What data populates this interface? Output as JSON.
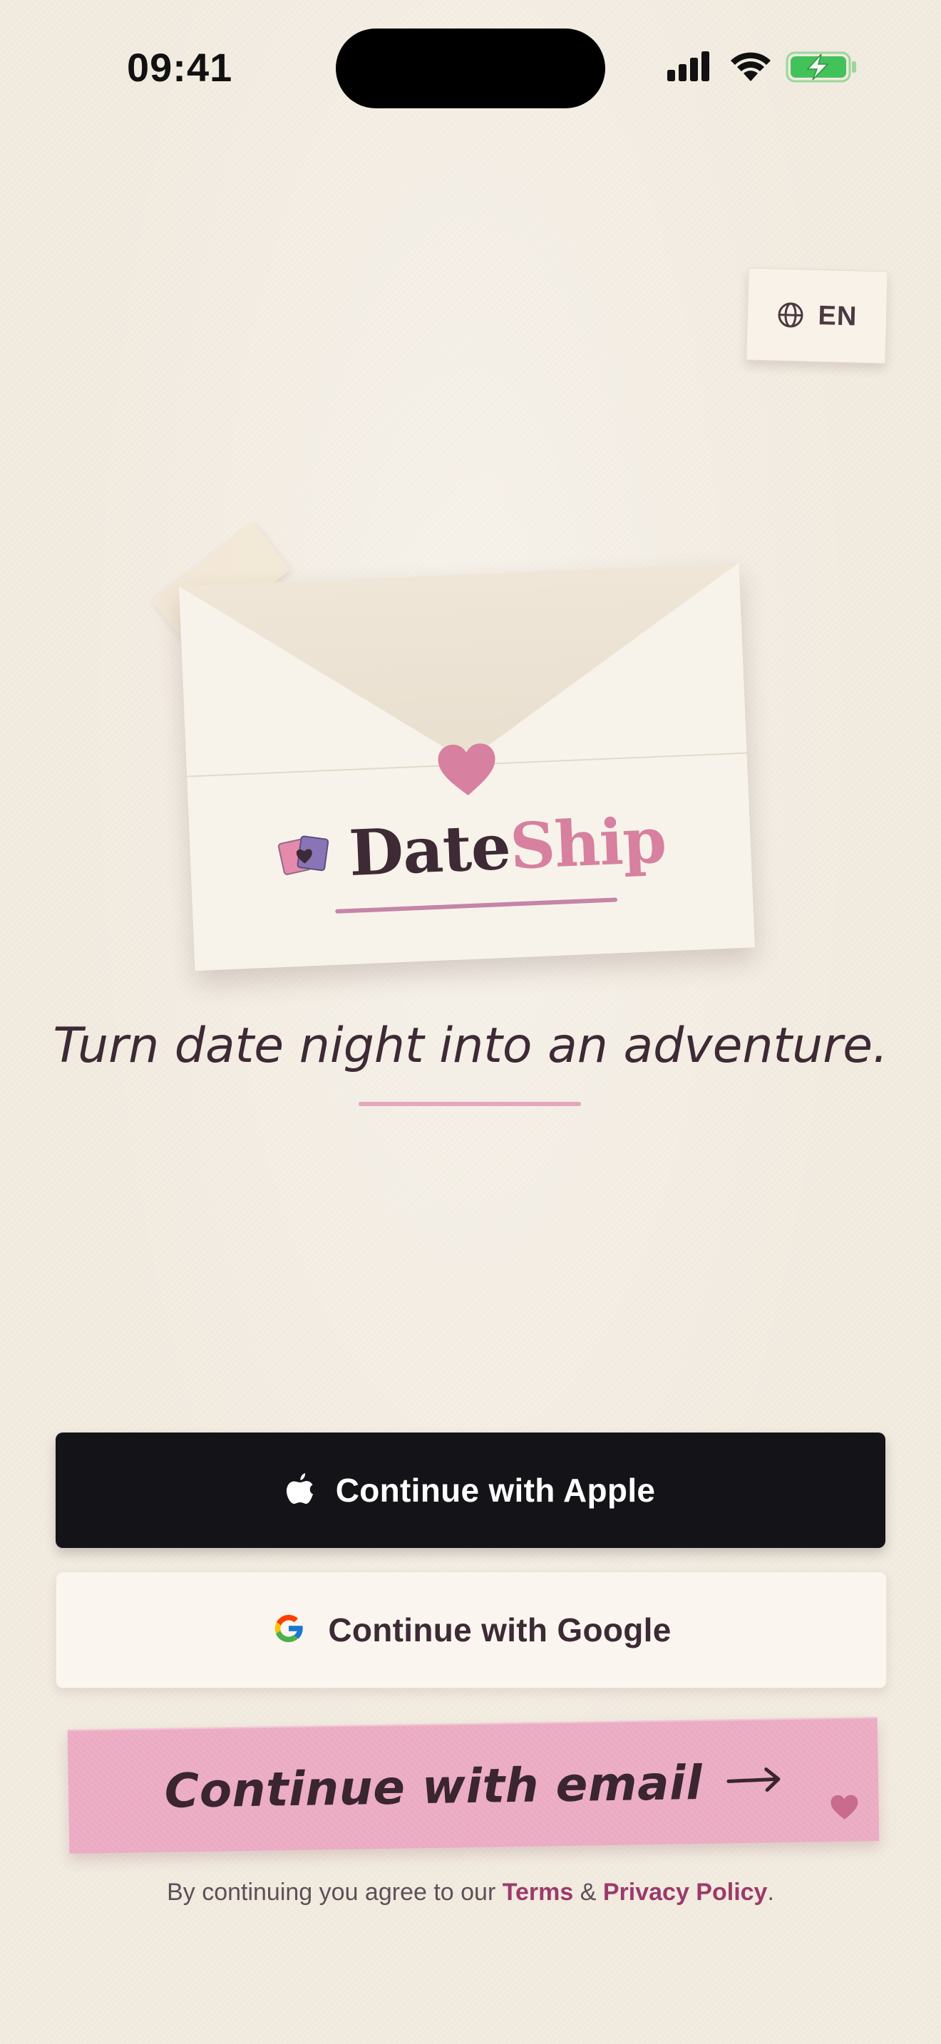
{
  "status_bar": {
    "time": "09:41"
  },
  "language": {
    "icon": "globe-icon",
    "label": "EN"
  },
  "logo": {
    "part1": "Date",
    "part2": "Ship",
    "icon": "cards-heart-icon",
    "seal_icon": "heart-icon"
  },
  "tagline": "Turn date night into an adventure.",
  "auth": {
    "apple_label": "Continue with Apple",
    "google_label": "Continue with Google",
    "email_label": "Continue with email",
    "email_arrow_icon": "arrow-right-icon"
  },
  "legal": {
    "prefix": "By continuing you agree to our",
    "terms": "Terms",
    "connector": "&",
    "privacy": "Privacy Policy",
    "suffix": "."
  },
  "colors": {
    "background": "#f2ebe0",
    "accent_pink": "#d7809f",
    "email_button": "#ebabc2",
    "apple_button": "#141317",
    "link": "#9b3a6a"
  }
}
